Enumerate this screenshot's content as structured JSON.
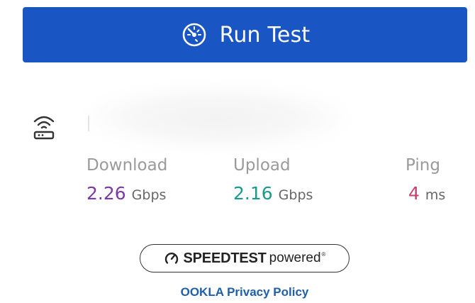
{
  "run_button": {
    "label": "Run Test",
    "icon": "speedometer-icon",
    "color": "#1a55c4"
  },
  "network": {
    "icon": "wifi-router-icon",
    "name": ""
  },
  "metrics": {
    "download": {
      "label": "Download",
      "value": "2.26",
      "unit": "Gbps",
      "color": "#7b3aa8"
    },
    "upload": {
      "label": "Upload",
      "value": "2.16",
      "unit": "Gbps",
      "color": "#1a9a8a"
    },
    "ping": {
      "label": "Ping",
      "value": "4",
      "unit": "ms",
      "color": "#c2436c"
    }
  },
  "powered_badge": {
    "brand": "SPEEDTEST",
    "suffix": "powered",
    "trademark": "®",
    "icon": "gauge-icon"
  },
  "privacy_link": {
    "label": "OOKLA Privacy Policy",
    "color": "#1f5fa8"
  }
}
